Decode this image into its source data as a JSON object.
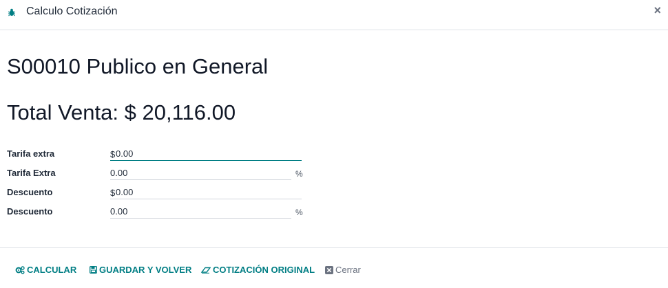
{
  "dialog": {
    "title": "Calculo Cotización",
    "close_symbol": "×"
  },
  "record": {
    "name": "S00010 Publico en General",
    "total_label": "Total Venta:",
    "total_value": "$ 20,116.00"
  },
  "fields": [
    {
      "label": "Tarifa extra",
      "prefix": "$",
      "value": "0.00",
      "suffix": ""
    },
    {
      "label": "Tarifa Extra",
      "prefix": "",
      "value": "0.00",
      "suffix": "%"
    },
    {
      "label": "Descuento",
      "prefix": "$",
      "value": "0.00",
      "suffix": ""
    },
    {
      "label": "Descuento",
      "prefix": "",
      "value": "0.00",
      "suffix": "%"
    }
  ],
  "footer": {
    "calcular": "CALCULAR",
    "guardar": "GUARDAR Y VOLVER",
    "original": "COTIZACIÓN ORIGINAL",
    "cerrar": "Cerrar"
  },
  "colors": {
    "accent": "#017e84",
    "muted": "#6b7280"
  }
}
